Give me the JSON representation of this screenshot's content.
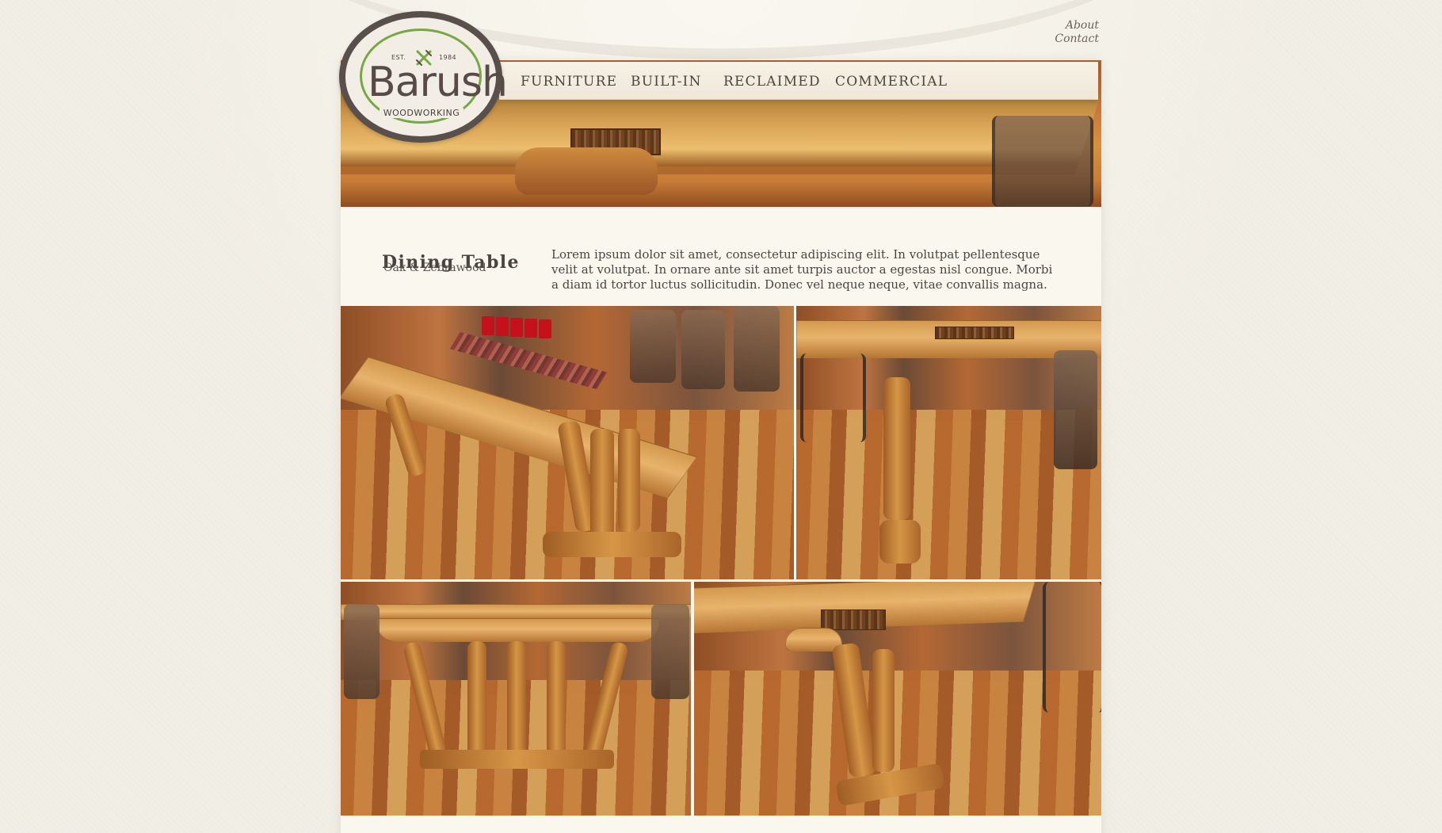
{
  "site": {
    "logo": {
      "brand": "Barush",
      "est": "EST.",
      "year": "1984",
      "tagline": "WOODWORKING"
    },
    "top_links": [
      {
        "label": "About"
      },
      {
        "label": "Contact"
      }
    ],
    "navigation": [
      {
        "label": "FURNITURE"
      },
      {
        "label": "BUILT-IN"
      },
      {
        "label": "RECLAIMED"
      },
      {
        "label": "COMMERCIAL"
      }
    ]
  },
  "intro": {
    "title": "Dining Table",
    "subtitle": "Oak & Zebrawood",
    "description": "Lorem ipsum dolor sit amet, consectetur adipiscing elit. In volutpat pellentesque velit at volutpat. In ornare ante sit amet turpis auctor a egestas nisl congue. Morbi a diam id tortor luctus sollicitudin. Donec vel neque neque, vitae convallis magna."
  },
  "gallery": {
    "photos": [
      {
        "label": "dining table overview"
      },
      {
        "label": "table end detail"
      },
      {
        "label": "table base front"
      },
      {
        "label": "table corner detail"
      }
    ]
  },
  "colors": {
    "background": "#f1eee6",
    "panel": "#faf7ef",
    "text": "#4b4340",
    "accent_green": "#77a844",
    "logo_border": "#5a504b"
  }
}
